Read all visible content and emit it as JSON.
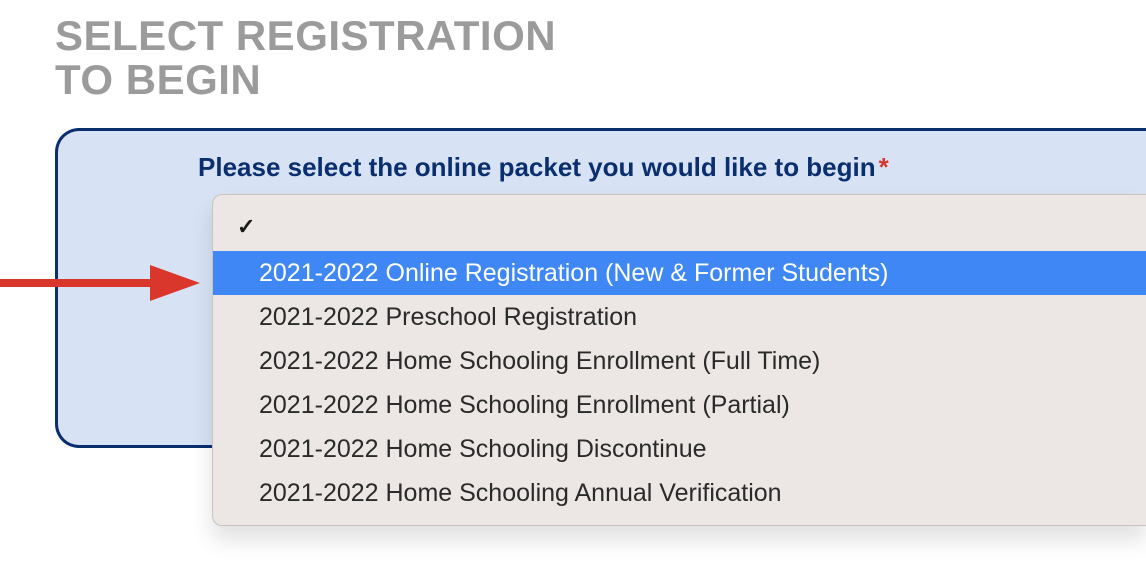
{
  "heading_line1": "SELECT REGISTRATION",
  "heading_line2": "TO BEGIN",
  "prompt_label": "Please select the online packet you would like to begin",
  "required_mark": "*",
  "dropdown": {
    "options": [
      {
        "label": "",
        "blank": true,
        "checked": true,
        "highlighted": false
      },
      {
        "label": "2021-2022 Online Registration (New & Former Students)",
        "blank": false,
        "checked": false,
        "highlighted": true
      },
      {
        "label": "2021-2022 Preschool Registration",
        "blank": false,
        "checked": false,
        "highlighted": false
      },
      {
        "label": "2021-2022 Home Schooling Enrollment (Full Time)",
        "blank": false,
        "checked": false,
        "highlighted": false
      },
      {
        "label": "2021-2022 Home Schooling Enrollment (Partial)",
        "blank": false,
        "checked": false,
        "highlighted": false
      },
      {
        "label": "2021-2022 Home Schooling Discontinue",
        "blank": false,
        "checked": false,
        "highlighted": false
      },
      {
        "label": "2021-2022 Home Schooling Annual Verification",
        "blank": false,
        "checked": false,
        "highlighted": false
      }
    ]
  },
  "colors": {
    "heading_gray": "#9b9b9b",
    "panel_bg": "#d7e3f5",
    "panel_border": "#0a2e6e",
    "prompt_text": "#0a2e6e",
    "required_red": "#d9372b",
    "dropdown_bg": "#ece7e4",
    "highlight_blue": "#3f87f5",
    "arrow_red": "#d9372b"
  }
}
